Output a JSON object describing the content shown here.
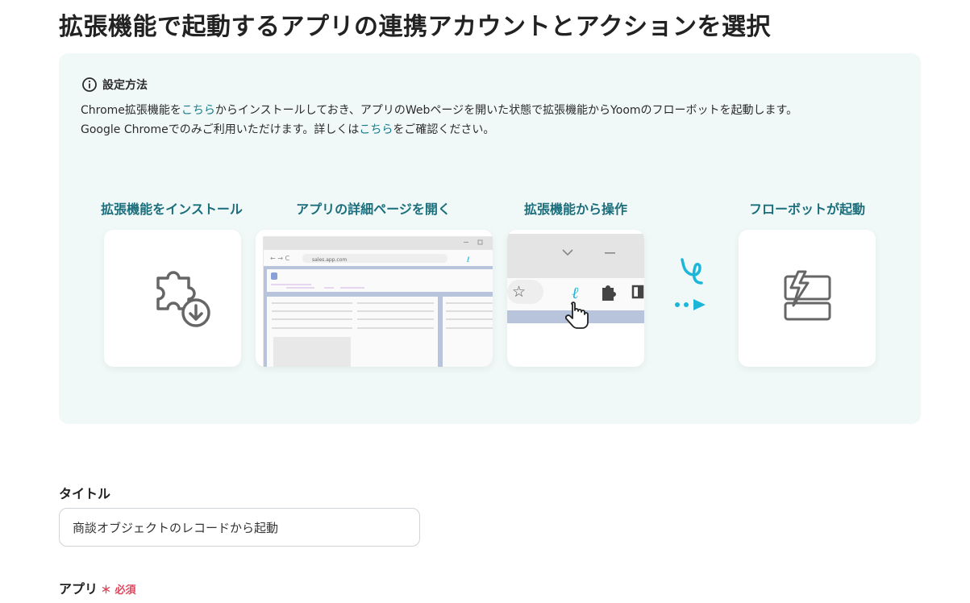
{
  "page": {
    "title": "拡張機能で起動するアプリの連携アカウントとアクションを選択"
  },
  "info": {
    "heading": "設定方法",
    "line1_prefix": "Chrome拡張機能を",
    "line1_link": "こちら",
    "line1_suffix": "からインストールしておき、アプリのWebページを開いた状態で拡張機能からYoomのフローボットを起動します。",
    "line2_prefix": "Google Chromeでのみご利用いただけます。詳しくは",
    "line2_link": "こちら",
    "line2_suffix": "をご確認ください。",
    "steps": [
      {
        "label": "拡張機能をインストール"
      },
      {
        "label": "アプリの詳細ページを開く"
      },
      {
        "label": "拡張機能から操作"
      },
      {
        "label": "フローボットが起動"
      }
    ],
    "browser_url": "sales.app.com"
  },
  "form": {
    "title_label": "タイトル",
    "title_value": "商談オブジェクトのレコードから起動",
    "app_label": "アプリ",
    "required_label": "＊ 必須"
  },
  "colors": {
    "accent": "#1b6e7c",
    "link": "#1a7b8a",
    "panel_bg": "#f1f9f8",
    "yoom_cyan": "#1cb6d8",
    "required": "#e0465e"
  }
}
